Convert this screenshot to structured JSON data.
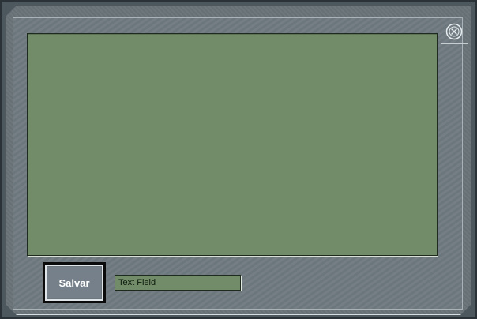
{
  "window": {
    "close_icon": "close-icon"
  },
  "form": {
    "save_label": "Salvar",
    "text_field_value": "Text Field"
  },
  "colors": {
    "frame": "#6a7479",
    "display": "#728b69",
    "button": "#75808a"
  }
}
